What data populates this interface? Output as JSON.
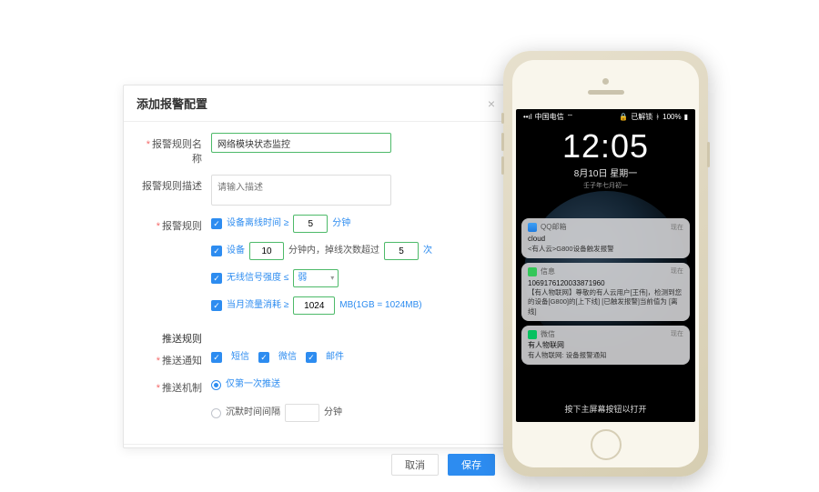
{
  "dialog": {
    "title": "添加报警配置",
    "labels": {
      "name": "报警规则名称",
      "desc": "报警规则描述",
      "rule": "报警规则",
      "push": "推送规则",
      "push_notify": "推送通知",
      "push_mech": "推送机制"
    },
    "name_value": "网络模块状态监控",
    "desc_placeholder": "请输入描述",
    "rules": {
      "offline_label": "设备离线时间 ≥",
      "offline_val": "5",
      "offline_unit": "分钟",
      "device_label": "设备",
      "device_val": "10",
      "device_mid": "分钟内，掉线次数超过",
      "device_val2": "5",
      "device_unit": "次",
      "signal_label": "无线信号强度 ≤",
      "signal_val": "弱",
      "traffic_label": "当月流量消耗 ≥",
      "traffic_val": "1024",
      "traffic_unit": "MB(1GB = 1024MB)"
    },
    "push": {
      "sms": "短信",
      "wechat": "微信",
      "email": "邮件"
    },
    "mech": {
      "once": "仅第一次推送",
      "silence": "沉默时间间隔",
      "silence_unit": "分钟"
    },
    "buttons": {
      "cancel": "取消",
      "save": "保存"
    }
  },
  "phone": {
    "status": {
      "carrier": "中国电信",
      "unlocked": "已解锁",
      "battery": "100%"
    },
    "clock": "12:05",
    "date": "8月10日 星期一",
    "subdate": "壬子年七月初一",
    "notifs": [
      {
        "app": "QQ邮箱",
        "time": "现在",
        "title": "cloud",
        "body": "<有人云>G800设备触发报警"
      },
      {
        "app": "信息",
        "time": "现在",
        "title": "1069176120033871960",
        "body": "【有人物联网】尊敬的有人云用户[王伟]，检测到您的设备[G800]的[上下线] [已触发报警]当前值为 [离线]"
      },
      {
        "app": "微信",
        "time": "现在",
        "title": "有人物联网",
        "body": "有人物联网: 设备报警通知"
      }
    ],
    "swipe": "按下主屏幕按钮以打开"
  }
}
